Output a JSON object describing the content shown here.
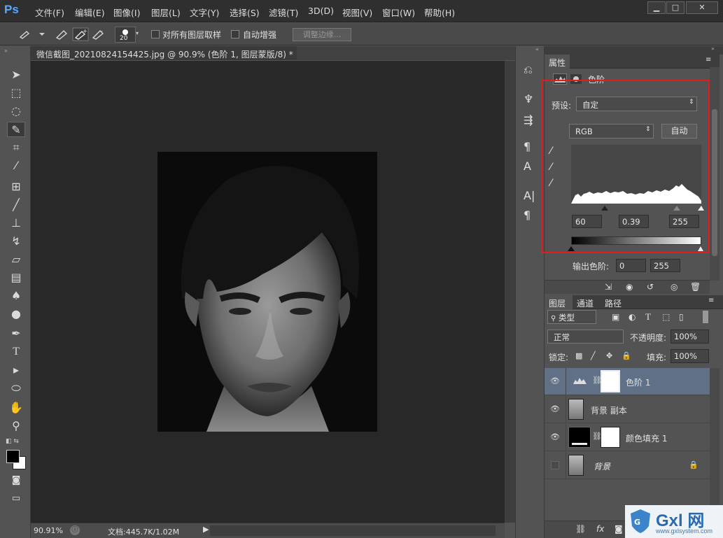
{
  "app": {
    "logo": "Ps"
  },
  "menu": [
    "文件(F)",
    "编辑(E)",
    "图像(I)",
    "图层(L)",
    "文字(Y)",
    "选择(S)",
    "滤镜(T)",
    "3D(D)",
    "视图(V)",
    "窗口(W)",
    "帮助(H)"
  ],
  "window_buttons": {
    "minimize": "▁",
    "maximize": "□",
    "close": "✕"
  },
  "options": {
    "brush_size": "20",
    "sample_all_label": "对所有图层取样",
    "auto_enhance_label": "自动增强",
    "refine_edge_label": "调整边缘..."
  },
  "document": {
    "tab_title": "微信截图_20210824154425.jpg @ 90.9% (色阶 1, 图层蒙版/8) *",
    "close": "×"
  },
  "status": {
    "zoom": "90.91%",
    "doc_info": "文档:445.7K/1.02M"
  },
  "properties": {
    "tab": "属性",
    "adjustment_name": "色阶",
    "preset_label": "预设:",
    "preset_value": "自定",
    "channel": "RGB",
    "auto_label": "自动",
    "input_black": "60",
    "input_gamma": "0.39",
    "input_white": "255",
    "output_label": "输出色阶:",
    "output_black": "0",
    "output_white": "255"
  },
  "layers_panel": {
    "tabs": [
      "图层",
      "通道",
      "路径"
    ],
    "filter_label": "类型",
    "blend_mode": "正常",
    "opacity_label": "不透明度:",
    "opacity_value": "100%",
    "lock_label": "锁定:",
    "fill_label": "填充:",
    "fill_value": "100%",
    "layers": [
      {
        "name": "色阶 1",
        "visible": true,
        "selected": true
      },
      {
        "name": "背景 副本",
        "visible": true,
        "selected": false
      },
      {
        "name": "颜色填充 1",
        "visible": true,
        "selected": false
      },
      {
        "name": "背景",
        "visible": false,
        "selected": false
      }
    ]
  },
  "watermark": {
    "brand": "Gxl 网",
    "url": "www.gxlsystem.com"
  },
  "colors": {
    "accent_blue": "#5aa9ff",
    "highlight_red": "#e21d1d",
    "selected_layer": "#5f7087"
  }
}
